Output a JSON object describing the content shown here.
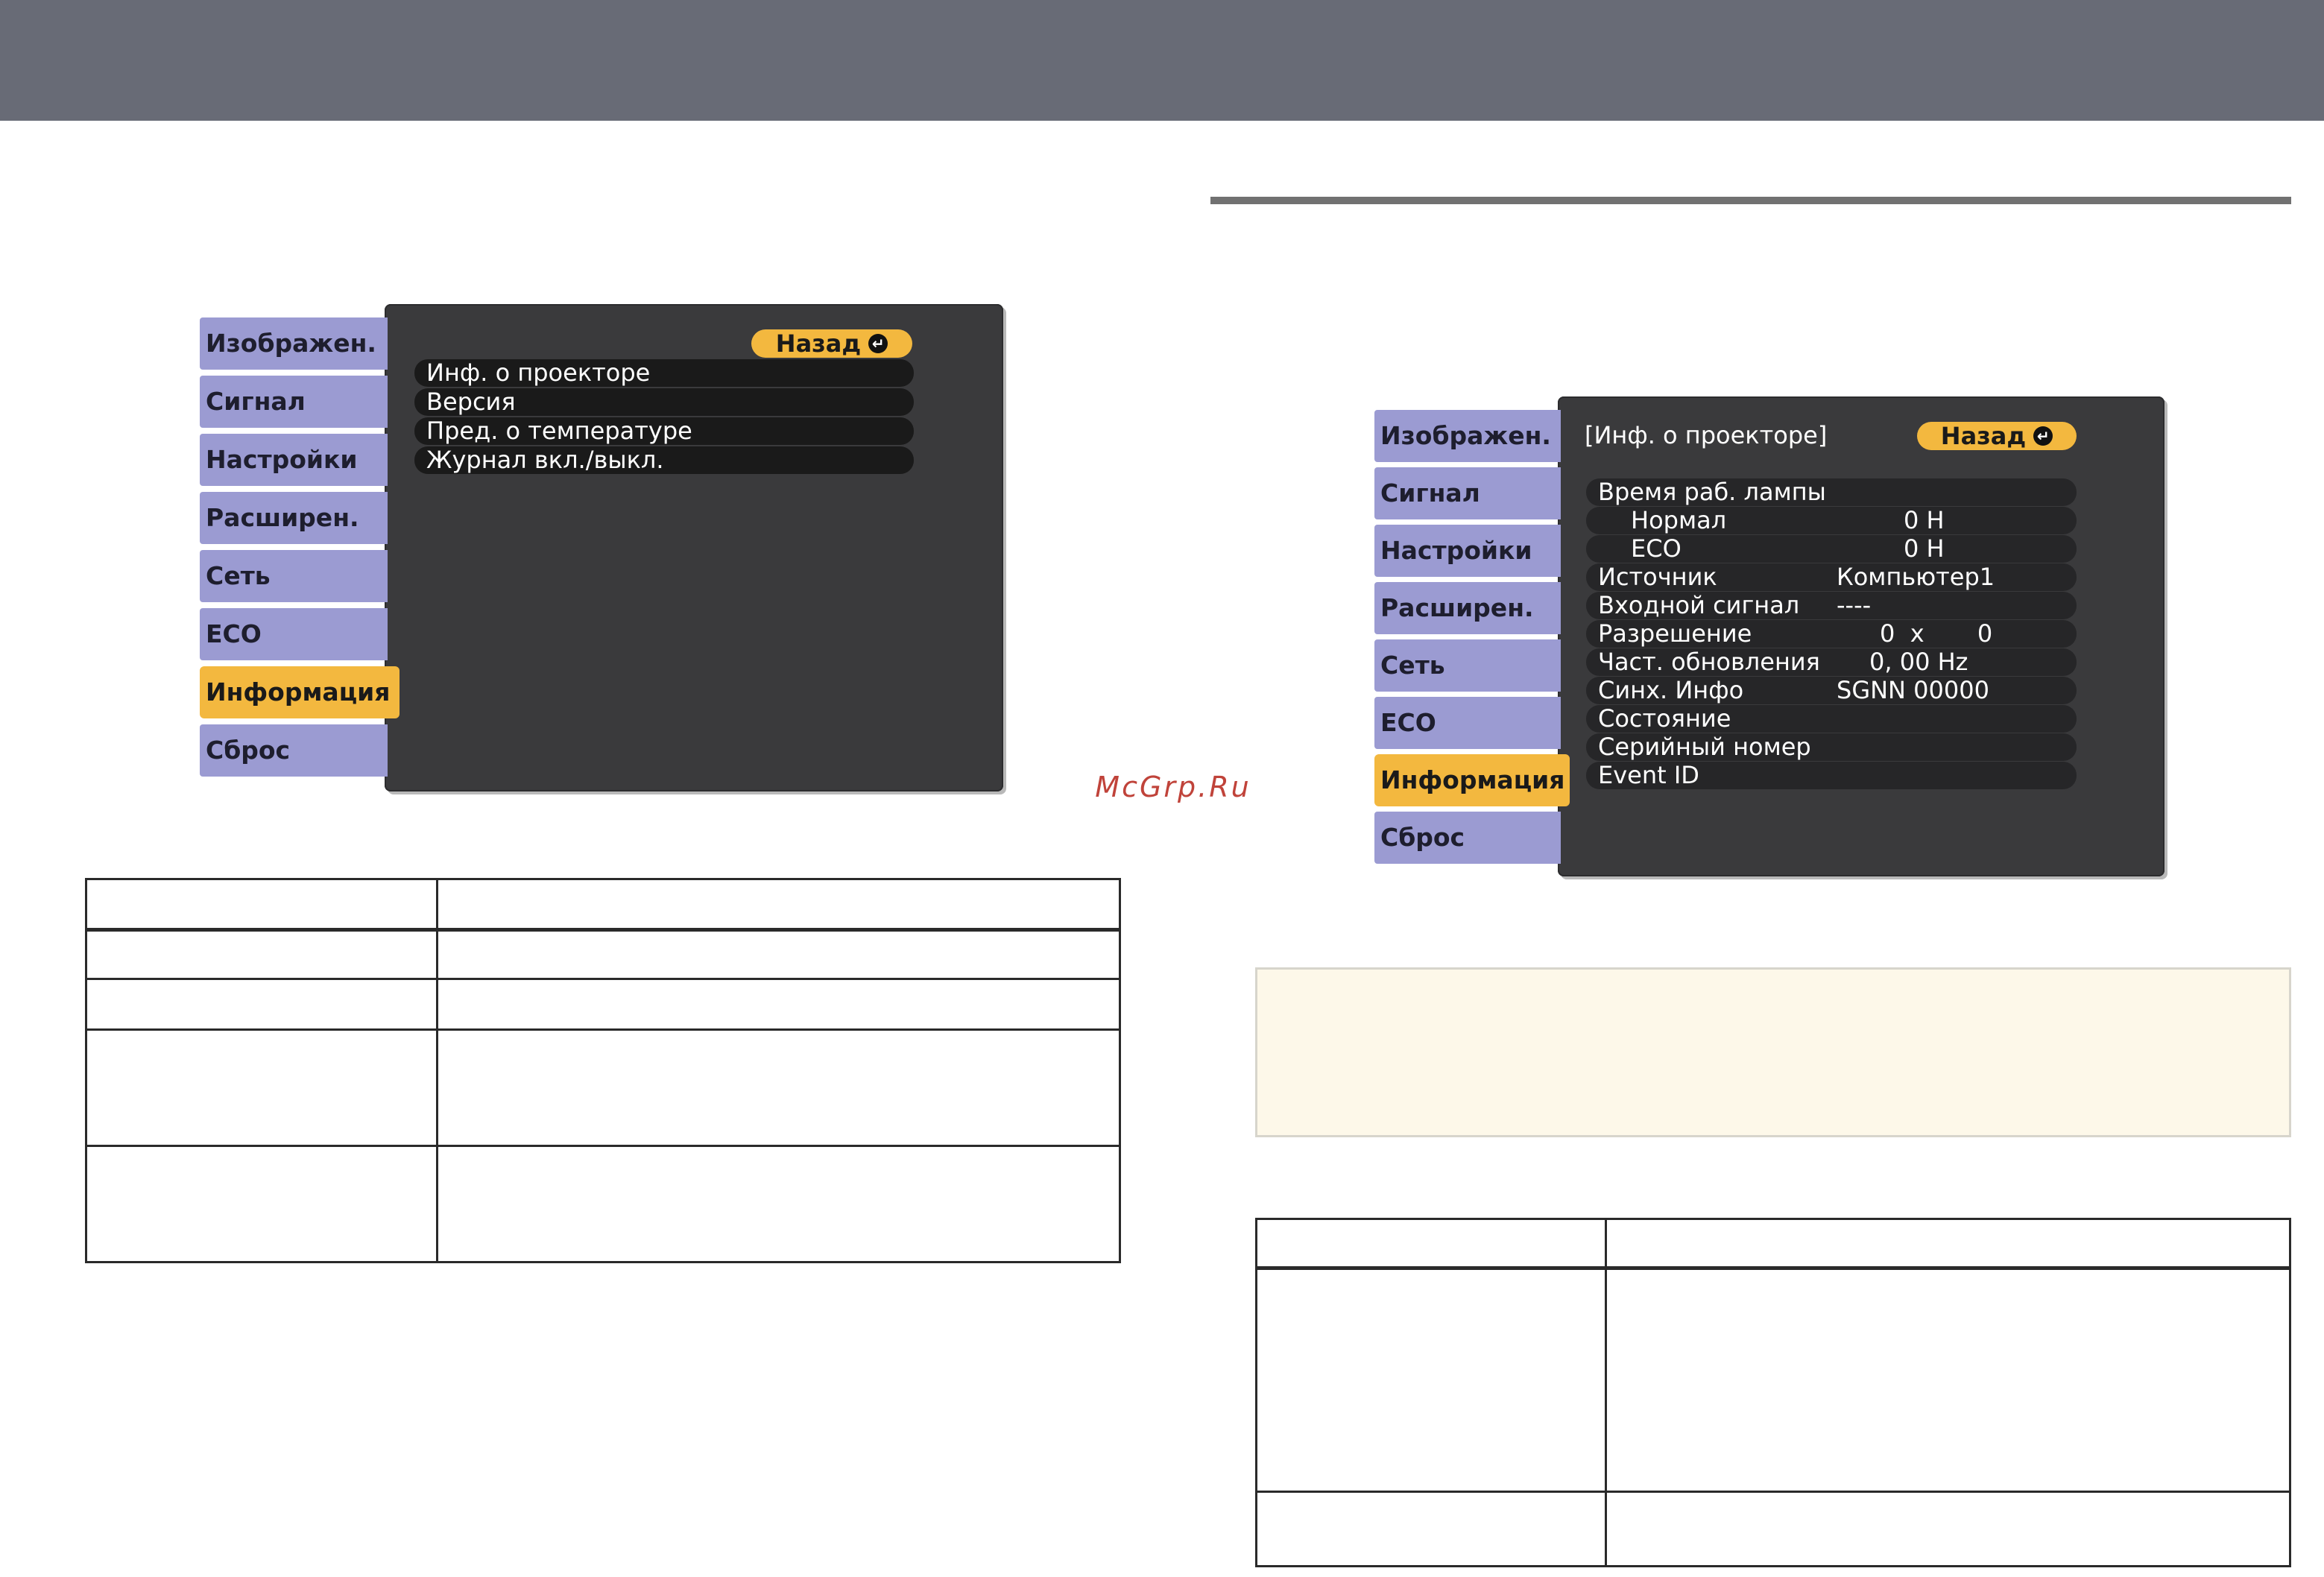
{
  "watermark": "McGrp.Ru",
  "colors": {
    "header_bar": "#686b76",
    "tab": "#9b9bd2",
    "tab_active": "#f3b83f",
    "panel": "#3a3a3c",
    "row": "#1a1a1a",
    "note_bg": "#fdf8e9"
  },
  "osd_left": {
    "tabs": [
      "Изображен.",
      "Сигнал",
      "Настройки",
      "Расширен.",
      "Сеть",
      "ECO",
      "Информация",
      "Сброс"
    ],
    "active_tab": "Информация",
    "back_label": "Назад",
    "return_icon": "return-icon",
    "items": [
      "Инф. о проекторе",
      "Версия",
      "Пред. о температуре",
      "Журнал вкл./выкл."
    ]
  },
  "osd_right": {
    "tabs": [
      "Изображен.",
      "Сигнал",
      "Настройки",
      "Расширен.",
      "Сеть",
      "ECO",
      "Информация",
      "Сброс"
    ],
    "active_tab": "Информация",
    "title": "[Инф. о проекторе]",
    "back_label": "Назад",
    "return_icon": "return-icon",
    "rows": [
      {
        "label": "Время раб. лампы",
        "value": ""
      },
      {
        "label": "Нормал",
        "value": "0  H"
      },
      {
        "label": "ECO",
        "value": "0  H"
      },
      {
        "label": "Источник",
        "value": "Компьютер1"
      },
      {
        "label": "Входной сигнал",
        "value": "----"
      },
      {
        "label": "Разрешение",
        "value": "0  x       0"
      },
      {
        "label": "Част. обновления",
        "value": "0, 00 Hz"
      },
      {
        "label": "Синх. Инфо",
        "value": "SGNN 00000"
      },
      {
        "label": "Состояние",
        "value": ""
      },
      {
        "label": "Серийный номер",
        "value": ""
      },
      {
        "label": "Event ID",
        "value": ""
      }
    ]
  }
}
